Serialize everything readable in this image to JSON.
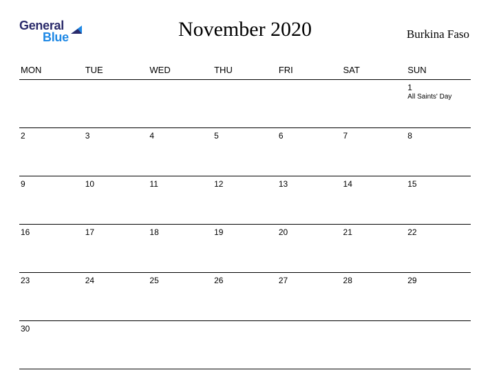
{
  "brand": {
    "line1": "General",
    "line2": "Blue"
  },
  "title": "November 2020",
  "country": "Burkina Faso",
  "dow": [
    "MON",
    "TUE",
    "WED",
    "THU",
    "FRI",
    "SAT",
    "SUN"
  ],
  "weeks": [
    [
      {
        "n": ""
      },
      {
        "n": ""
      },
      {
        "n": ""
      },
      {
        "n": ""
      },
      {
        "n": ""
      },
      {
        "n": ""
      },
      {
        "n": "1",
        "event": "All Saints' Day"
      }
    ],
    [
      {
        "n": "2"
      },
      {
        "n": "3"
      },
      {
        "n": "4"
      },
      {
        "n": "5"
      },
      {
        "n": "6"
      },
      {
        "n": "7"
      },
      {
        "n": "8"
      }
    ],
    [
      {
        "n": "9"
      },
      {
        "n": "10"
      },
      {
        "n": "11"
      },
      {
        "n": "12"
      },
      {
        "n": "13"
      },
      {
        "n": "14"
      },
      {
        "n": "15"
      }
    ],
    [
      {
        "n": "16"
      },
      {
        "n": "17"
      },
      {
        "n": "18"
      },
      {
        "n": "19"
      },
      {
        "n": "20"
      },
      {
        "n": "21"
      },
      {
        "n": "22"
      }
    ],
    [
      {
        "n": "23"
      },
      {
        "n": "24"
      },
      {
        "n": "25"
      },
      {
        "n": "26"
      },
      {
        "n": "27"
      },
      {
        "n": "28"
      },
      {
        "n": "29"
      }
    ],
    [
      {
        "n": "30"
      },
      {
        "n": ""
      },
      {
        "n": ""
      },
      {
        "n": ""
      },
      {
        "n": ""
      },
      {
        "n": ""
      },
      {
        "n": ""
      }
    ]
  ]
}
